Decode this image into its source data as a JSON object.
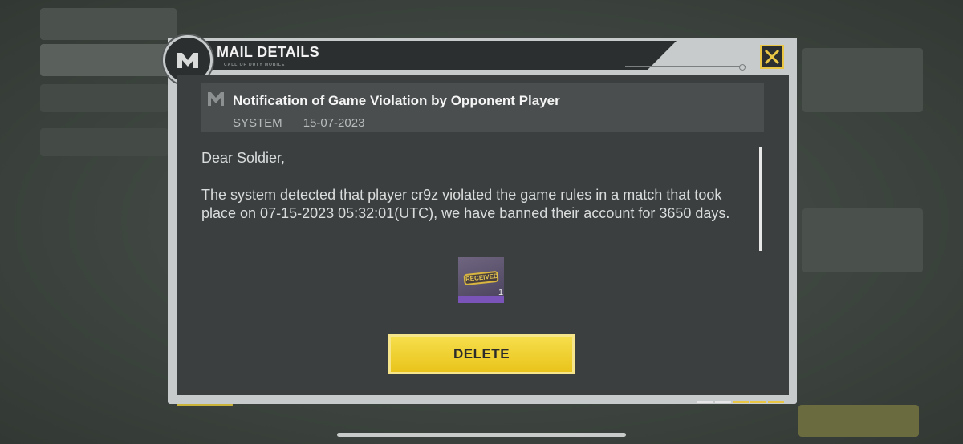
{
  "header": {
    "title": "MAIL DETAILS",
    "subtitle": "CALL OF DUTY MOBILE",
    "logo_icon": "cod-mobile-logo-icon",
    "close_icon": "close-x-icon"
  },
  "mail": {
    "title": "Notification of Game Violation by Opponent Player",
    "sender": "SYSTEM",
    "date": "15-07-2023",
    "greeting": "Dear Soldier,",
    "body": "The system detected that player cr9z violated the game rules in a match that took place on 07-15-2023 05:32:01(UTC), we have banned their account for 3650 days."
  },
  "reward": {
    "label": "RECEIVED",
    "count": "1"
  },
  "actions": {
    "delete_label": "DELETE"
  },
  "colors": {
    "accent": "#e9c41b",
    "panel": "#3b3f3f",
    "frame": "#c7cbcb"
  }
}
